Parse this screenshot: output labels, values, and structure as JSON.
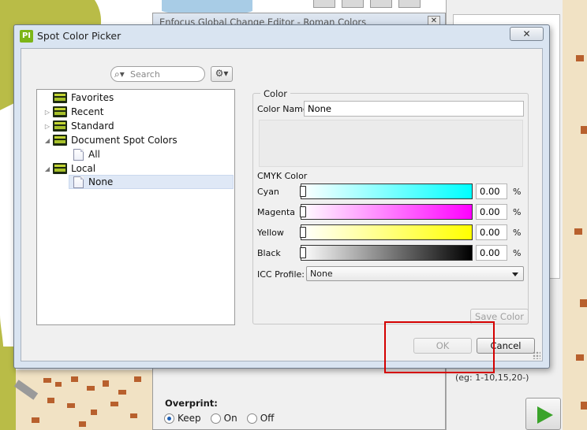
{
  "background": {
    "window_title": "Enfocus Global Change Editor - Roman Colors",
    "window_close": "✕",
    "range_hint": "(eg: 1-10,15,20-)",
    "overprint_label": "Overprint:",
    "overprint_options": [
      "Keep",
      "On",
      "Off"
    ],
    "overprint_selected": "Keep"
  },
  "dialog": {
    "app_icon": "PI",
    "title": "Spot Color Picker",
    "close_glyph": "✕",
    "search_placeholder": "Search",
    "gear_glyph": "⚙▾",
    "tree": [
      {
        "label": "Favorites",
        "icon": "folder-icon",
        "arrow": ""
      },
      {
        "label": "Recent",
        "icon": "folder-icon",
        "arrow": "▷"
      },
      {
        "label": "Standard",
        "icon": "folder-icon",
        "arrow": "▷"
      },
      {
        "label": "Document Spot Colors",
        "icon": "folder-icon",
        "arrow": "◢"
      },
      {
        "label": "All",
        "icon": "doc-icon",
        "arrow": ""
      },
      {
        "label": "Local",
        "icon": "folder-icon",
        "arrow": "◢"
      },
      {
        "label": "None",
        "icon": "doc-icon",
        "arrow": "",
        "selected": true
      }
    ],
    "color_group_label": "Color",
    "color_name_label": "Color Name",
    "color_name_value": "None",
    "cmyk_label": "CMYK Color",
    "channels": [
      {
        "label": "Cyan",
        "value": "0.00",
        "unit": "%",
        "color": "#00ffff"
      },
      {
        "label": "Magenta",
        "value": "0.00",
        "unit": "%",
        "color": "#ff00ff"
      },
      {
        "label": "Yellow",
        "value": "0.00",
        "unit": "%",
        "color": "#ffff00"
      },
      {
        "label": "Black",
        "value": "0.00",
        "unit": "%",
        "color": "#000000"
      }
    ],
    "icc_label": "ICC Profile:",
    "icc_value": "None",
    "save_color_label": "Save Color",
    "ok_label": "OK",
    "cancel_label": "Cancel"
  }
}
